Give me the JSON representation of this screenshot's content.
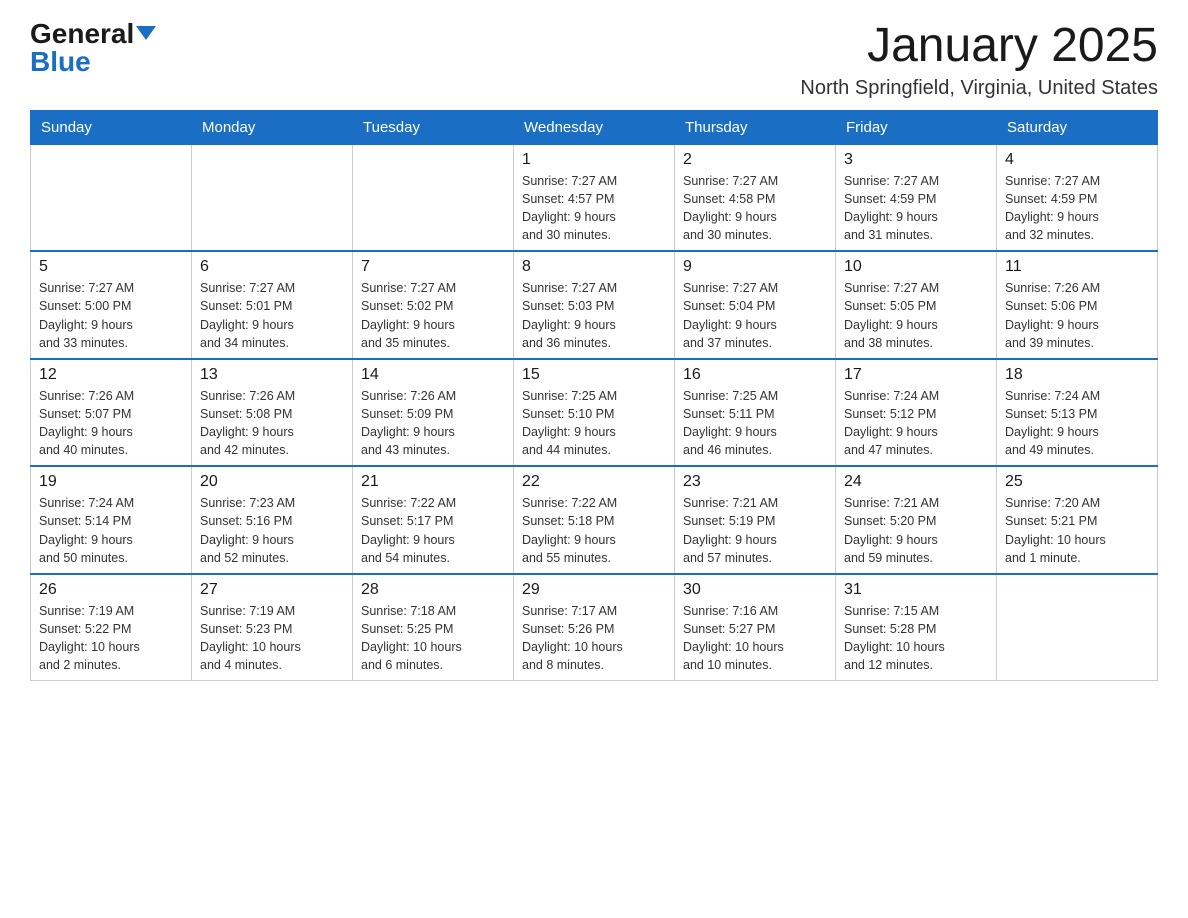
{
  "header": {
    "logo_general": "General",
    "logo_blue": "Blue",
    "month_title": "January 2025",
    "location": "North Springfield, Virginia, United States"
  },
  "weekdays": [
    "Sunday",
    "Monday",
    "Tuesday",
    "Wednesday",
    "Thursday",
    "Friday",
    "Saturday"
  ],
  "weeks": [
    {
      "days": [
        {
          "num": "",
          "info": ""
        },
        {
          "num": "",
          "info": ""
        },
        {
          "num": "",
          "info": ""
        },
        {
          "num": "1",
          "info": "Sunrise: 7:27 AM\nSunset: 4:57 PM\nDaylight: 9 hours\nand 30 minutes."
        },
        {
          "num": "2",
          "info": "Sunrise: 7:27 AM\nSunset: 4:58 PM\nDaylight: 9 hours\nand 30 minutes."
        },
        {
          "num": "3",
          "info": "Sunrise: 7:27 AM\nSunset: 4:59 PM\nDaylight: 9 hours\nand 31 minutes."
        },
        {
          "num": "4",
          "info": "Sunrise: 7:27 AM\nSunset: 4:59 PM\nDaylight: 9 hours\nand 32 minutes."
        }
      ]
    },
    {
      "days": [
        {
          "num": "5",
          "info": "Sunrise: 7:27 AM\nSunset: 5:00 PM\nDaylight: 9 hours\nand 33 minutes."
        },
        {
          "num": "6",
          "info": "Sunrise: 7:27 AM\nSunset: 5:01 PM\nDaylight: 9 hours\nand 34 minutes."
        },
        {
          "num": "7",
          "info": "Sunrise: 7:27 AM\nSunset: 5:02 PM\nDaylight: 9 hours\nand 35 minutes."
        },
        {
          "num": "8",
          "info": "Sunrise: 7:27 AM\nSunset: 5:03 PM\nDaylight: 9 hours\nand 36 minutes."
        },
        {
          "num": "9",
          "info": "Sunrise: 7:27 AM\nSunset: 5:04 PM\nDaylight: 9 hours\nand 37 minutes."
        },
        {
          "num": "10",
          "info": "Sunrise: 7:27 AM\nSunset: 5:05 PM\nDaylight: 9 hours\nand 38 minutes."
        },
        {
          "num": "11",
          "info": "Sunrise: 7:26 AM\nSunset: 5:06 PM\nDaylight: 9 hours\nand 39 minutes."
        }
      ]
    },
    {
      "days": [
        {
          "num": "12",
          "info": "Sunrise: 7:26 AM\nSunset: 5:07 PM\nDaylight: 9 hours\nand 40 minutes."
        },
        {
          "num": "13",
          "info": "Sunrise: 7:26 AM\nSunset: 5:08 PM\nDaylight: 9 hours\nand 42 minutes."
        },
        {
          "num": "14",
          "info": "Sunrise: 7:26 AM\nSunset: 5:09 PM\nDaylight: 9 hours\nand 43 minutes."
        },
        {
          "num": "15",
          "info": "Sunrise: 7:25 AM\nSunset: 5:10 PM\nDaylight: 9 hours\nand 44 minutes."
        },
        {
          "num": "16",
          "info": "Sunrise: 7:25 AM\nSunset: 5:11 PM\nDaylight: 9 hours\nand 46 minutes."
        },
        {
          "num": "17",
          "info": "Sunrise: 7:24 AM\nSunset: 5:12 PM\nDaylight: 9 hours\nand 47 minutes."
        },
        {
          "num": "18",
          "info": "Sunrise: 7:24 AM\nSunset: 5:13 PM\nDaylight: 9 hours\nand 49 minutes."
        }
      ]
    },
    {
      "days": [
        {
          "num": "19",
          "info": "Sunrise: 7:24 AM\nSunset: 5:14 PM\nDaylight: 9 hours\nand 50 minutes."
        },
        {
          "num": "20",
          "info": "Sunrise: 7:23 AM\nSunset: 5:16 PM\nDaylight: 9 hours\nand 52 minutes."
        },
        {
          "num": "21",
          "info": "Sunrise: 7:22 AM\nSunset: 5:17 PM\nDaylight: 9 hours\nand 54 minutes."
        },
        {
          "num": "22",
          "info": "Sunrise: 7:22 AM\nSunset: 5:18 PM\nDaylight: 9 hours\nand 55 minutes."
        },
        {
          "num": "23",
          "info": "Sunrise: 7:21 AM\nSunset: 5:19 PM\nDaylight: 9 hours\nand 57 minutes."
        },
        {
          "num": "24",
          "info": "Sunrise: 7:21 AM\nSunset: 5:20 PM\nDaylight: 9 hours\nand 59 minutes."
        },
        {
          "num": "25",
          "info": "Sunrise: 7:20 AM\nSunset: 5:21 PM\nDaylight: 10 hours\nand 1 minute."
        }
      ]
    },
    {
      "days": [
        {
          "num": "26",
          "info": "Sunrise: 7:19 AM\nSunset: 5:22 PM\nDaylight: 10 hours\nand 2 minutes."
        },
        {
          "num": "27",
          "info": "Sunrise: 7:19 AM\nSunset: 5:23 PM\nDaylight: 10 hours\nand 4 minutes."
        },
        {
          "num": "28",
          "info": "Sunrise: 7:18 AM\nSunset: 5:25 PM\nDaylight: 10 hours\nand 6 minutes."
        },
        {
          "num": "29",
          "info": "Sunrise: 7:17 AM\nSunset: 5:26 PM\nDaylight: 10 hours\nand 8 minutes."
        },
        {
          "num": "30",
          "info": "Sunrise: 7:16 AM\nSunset: 5:27 PM\nDaylight: 10 hours\nand 10 minutes."
        },
        {
          "num": "31",
          "info": "Sunrise: 7:15 AM\nSunset: 5:28 PM\nDaylight: 10 hours\nand 12 minutes."
        },
        {
          "num": "",
          "info": ""
        }
      ]
    }
  ]
}
